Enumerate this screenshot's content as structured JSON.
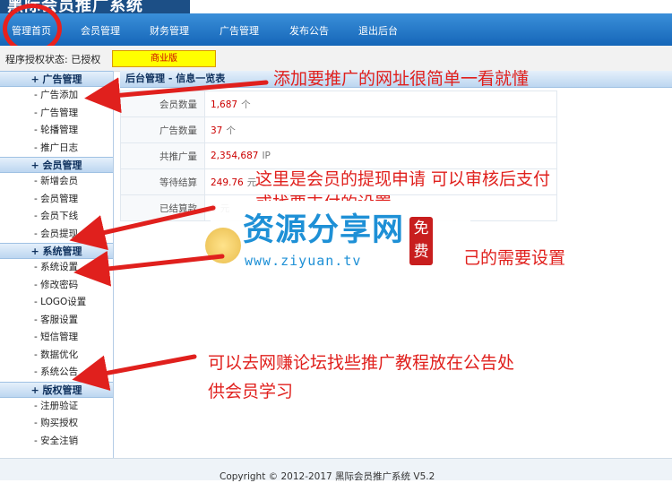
{
  "app": {
    "title_fragment": "黑际会员推广系统"
  },
  "topnav": {
    "items": [
      {
        "label": "管理首页"
      },
      {
        "label": "会员管理"
      },
      {
        "label": "财务管理"
      },
      {
        "label": "广告管理"
      },
      {
        "label": "发布公告"
      },
      {
        "label": "退出后台"
      }
    ]
  },
  "status": {
    "label": "程序授权状态: 已授权",
    "badge": "商业版"
  },
  "sidebar": {
    "sections": [
      {
        "title": "+ 广告管理",
        "items": [
          "- 广告添加",
          "- 广告管理",
          "- 轮播管理",
          "- 推广日志"
        ]
      },
      {
        "title": "+ 会员管理",
        "items": [
          "- 新增会员",
          "- 会员管理",
          "- 会员下线",
          "- 会员提现"
        ]
      },
      {
        "title": "+ 系统管理",
        "items": [
          "- 系统设置",
          "- 修改密码",
          "- LOGO设置",
          "- 客服设置",
          "- 短信管理",
          "- 数据优化",
          "- 系统公告"
        ]
      },
      {
        "title": "+ 版权管理",
        "items": [
          "- 注册验证",
          "- 购买授权",
          "- 安全注销"
        ]
      }
    ]
  },
  "main": {
    "panel_title": "后台管理 - 信息一览表",
    "stats": [
      {
        "label": "会员数量",
        "value": "1,687",
        "unit": "个"
      },
      {
        "label": "广告数量",
        "value": "37",
        "unit": "个"
      },
      {
        "label": "共推广量",
        "value": "2,354,687",
        "unit": "IP"
      },
      {
        "label": "等待结算",
        "value": "249.76",
        "unit": "元"
      },
      {
        "label": "已结算款",
        "value": "0",
        "unit": "元"
      }
    ]
  },
  "annotations": {
    "note1": "添加要推广的网址很简单一看就懂",
    "note2": "这里是会员的提现申请 可以审核后支付",
    "note2_cont": "或找要支付的设置",
    "note3": "己的需要设置",
    "note4_line1": "可以去网赚论坛找些推广教程放在公告处",
    "note4_line2": "供会员学习",
    "color": "#e0201d"
  },
  "watermark": {
    "title": "资源分享网",
    "url": "www.ziyuan.tv",
    "seal": "免费"
  },
  "footer": {
    "text": "Copyright © 2012-2017 黑际会员推广系统 V5.2"
  }
}
